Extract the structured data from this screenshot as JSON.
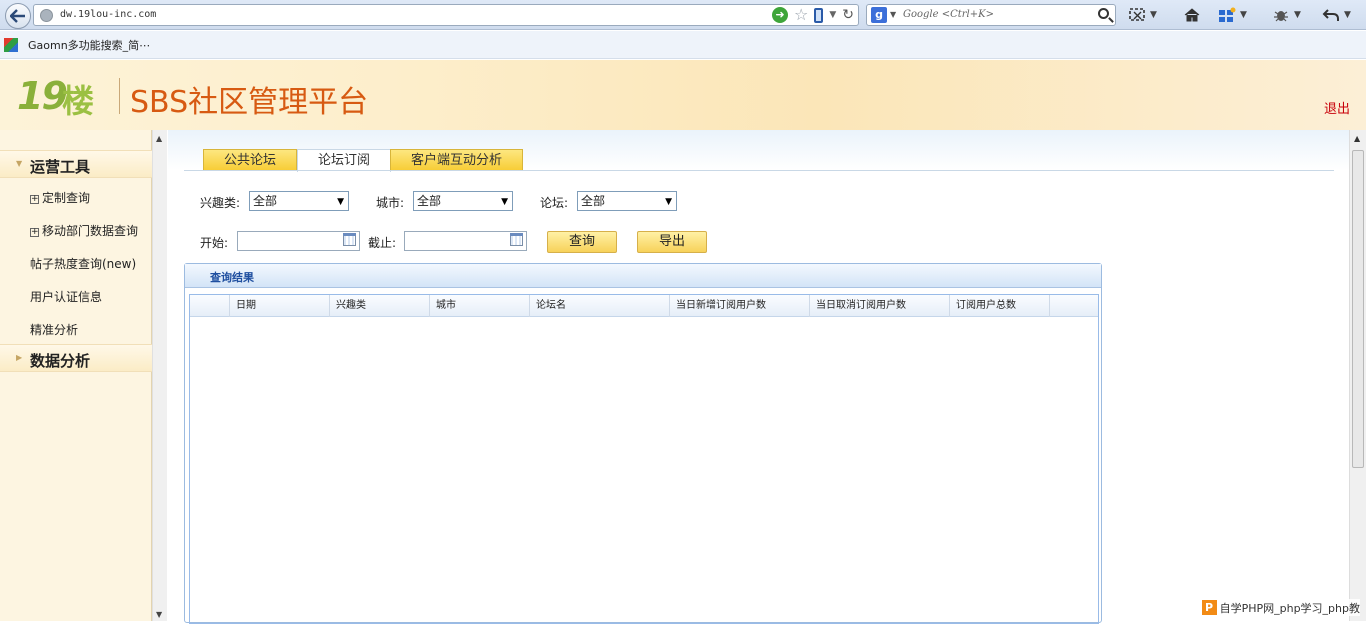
{
  "browser": {
    "url": "dw.19lou-inc.com",
    "search_placeholder": "Google <Ctrl+K>",
    "search_engine_letter": "g"
  },
  "bookmarks": [
    {
      "label": "Gaomn多功能搜索_简⋯"
    }
  ],
  "header": {
    "logo_number": "19",
    "logo_char": "楼",
    "title": "SBS社区管理平台",
    "logout": "退出"
  },
  "sidebar": {
    "groups": [
      {
        "label": "运营工具",
        "items": [
          {
            "label": "定制查询",
            "expandable": true
          },
          {
            "label": "移动部门数据查询",
            "expandable": true
          },
          {
            "label": "帖子热度查询(new)",
            "expandable": false
          },
          {
            "label": "用户认证信息",
            "expandable": false
          },
          {
            "label": "精准分析",
            "expandable": false
          }
        ]
      },
      {
        "label": "数据分析",
        "items": []
      }
    ]
  },
  "tabs": [
    {
      "label": "公共论坛",
      "active": false
    },
    {
      "label": "论坛订阅",
      "active": true
    },
    {
      "label": "客户端互动分析",
      "active": false
    }
  ],
  "filters": {
    "interest_label": "兴趣类:",
    "interest_value": "全部",
    "city_label": "城市:",
    "city_value": "全部",
    "forum_label": "论坛:",
    "forum_value": "全部",
    "start_label": "开始:",
    "end_label": "截止:",
    "start_value": "",
    "end_value": "",
    "query_button": "查询",
    "export_button": "导出"
  },
  "results": {
    "title": "查询结果",
    "columns": [
      "日期",
      "兴趣类",
      "城市",
      "论坛名",
      "当日新增订阅用户数",
      "当日取消订阅用户数",
      "订阅用户总数"
    ],
    "rows": []
  },
  "watermark": {
    "logo": "P",
    "text": "自学PHP网_php学习_php教"
  },
  "colors": {
    "title_orange": "#d75a12",
    "logo_green": "#8ab03a",
    "logout_red": "#c8000a",
    "tab_yellow": "#f7cc33",
    "panel_blue": "#1f4fa0"
  }
}
